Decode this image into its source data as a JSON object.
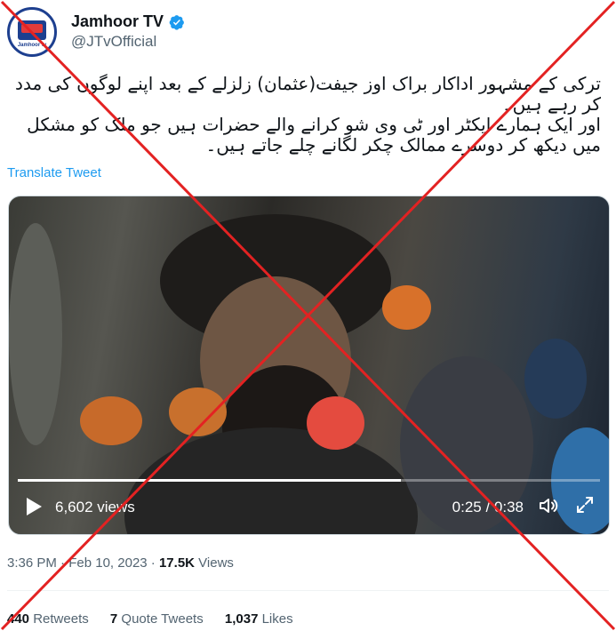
{
  "account": {
    "display_name": "Jamhoor TV",
    "handle": "@JTvOfficial",
    "logo_text": "Jamhoor tv",
    "verified_color": "#1d9bf0"
  },
  "tweet": {
    "lines": [
      "ترکی کے مشہور اداکار براک اوز جیفت(عثمان) زلزلے کے بعد اپنے لوگوں کی مدد کر رہے ہیں۔",
      "اور ایک ہمارے ایکٹر اور ٹی وی شو کرانے والے حضرات ہیں جو ملک کو مشکل میں دیکھ کر دوسرے ممالک چکر لگانے چلے جاتے ہیں۔"
    ],
    "translate_label": "Translate Tweet"
  },
  "video": {
    "views": "6,602 views",
    "time": "0:25 / 0:38",
    "progress": 0.658
  },
  "meta": {
    "time": "3:36 PM",
    "sep1": "·",
    "date": "Feb 10, 2023",
    "sep2": "·",
    "views_count": "17.5K",
    "views_label": "Views"
  },
  "stats": {
    "retweets_count": "440",
    "retweets_label": "Retweets",
    "quotes_count": "7",
    "quotes_label": "Quote Tweets",
    "likes_count": "1,037",
    "likes_label": "Likes"
  },
  "colors": {
    "accent": "#1d9bf0",
    "cross": "#e32222"
  }
}
